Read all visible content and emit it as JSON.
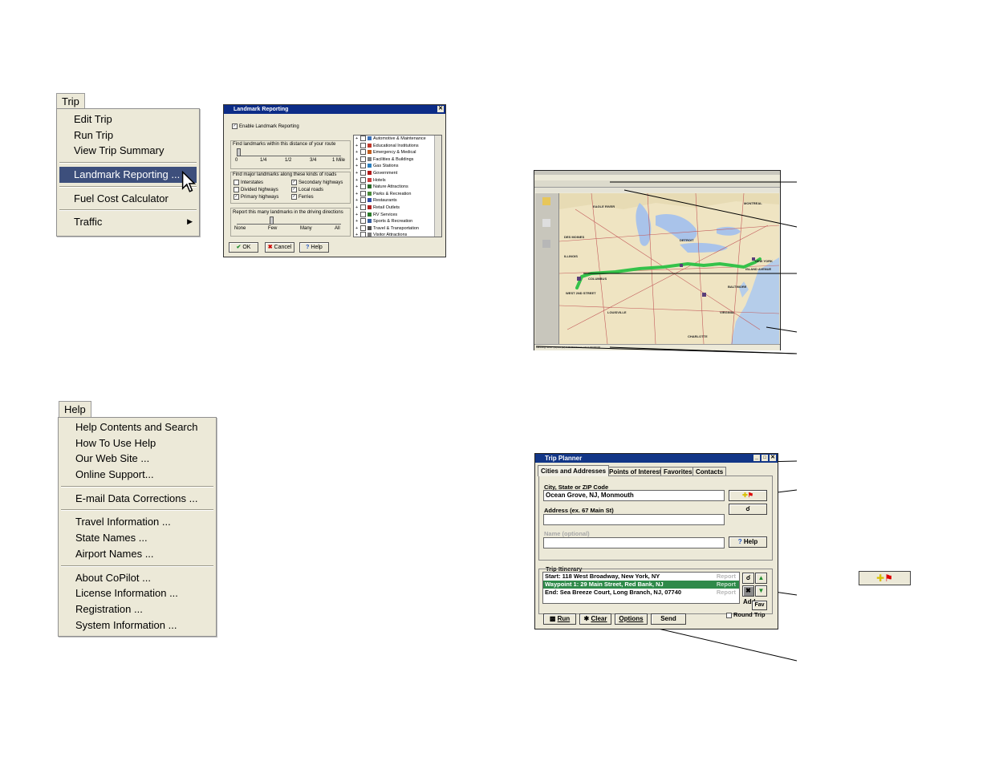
{
  "trip_menu": {
    "title": "Trip",
    "items": [
      "Edit Trip",
      "Run Trip",
      "View Trip Summary",
      "Landmark Reporting ...",
      "Fuel Cost Calculator",
      "Traffic"
    ]
  },
  "help_menu": {
    "title": "Help",
    "items": [
      "Help Contents and Search",
      "How To Use Help",
      "Our Web Site ...",
      "Online Support...",
      "E-mail Data Corrections ...",
      "Travel Information ...",
      "State Names ...",
      "Airport Names ...",
      "About CoPilot ...",
      "License Information ...",
      "Registration ...",
      "System Information ..."
    ]
  },
  "landmark_dialog": {
    "title": "Landmark Reporting",
    "enable_label": "Enable Landmark Reporting",
    "distance_caption": "Find landmarks within this distance of your route",
    "distance_ticks": [
      "0",
      "1/4",
      "1/2",
      "3/4",
      "1 Mile"
    ],
    "roads_caption": "Find major landmarks along these kinds of roads",
    "roads": [
      {
        "label": "Interstates",
        "checked": false
      },
      {
        "label": "Secondary highways",
        "checked": true
      },
      {
        "label": "Divided highways",
        "checked": false
      },
      {
        "label": "Local roads",
        "checked": true
      },
      {
        "label": "Primary highways",
        "checked": true
      },
      {
        "label": "Ferries",
        "checked": true
      }
    ],
    "report_caption": "Report this many landmarks in the driving directions",
    "report_ticks": [
      "None",
      "Few",
      "Many",
      "All"
    ],
    "categories": [
      "Automotive & Maintenance",
      "Educational Institutions",
      "Emergency & Medical",
      "Facilities & Buildings",
      "Gas Stations",
      "Government",
      "Hotels",
      "Nature Attractions",
      "Parks & Recreation",
      "Restaurants",
      "Retail Outlets",
      "RV Services",
      "Sports & Recreation",
      "Travel & Transportation",
      "Visitor Attractions"
    ],
    "ok_label": "OK",
    "cancel_label": "Cancel",
    "help_label": "Help"
  },
  "map_window": {
    "status_text": "Lat/Long: 40.27 (N) 0.0 (W) 0.00 BUFFALO, NY 0.00000000",
    "place_labels": [
      "EAGLE RIVER",
      "MONTREAL",
      "DES MOINES",
      "WEST 2ND STREET",
      "COLUMBUS",
      "DETROIT",
      "ILLINOIS",
      "ISLAND AVENUE",
      "NEW YORK",
      "BALTIMORE",
      "VIRGINIA",
      "LOUISVILLE",
      "CHARLOTTE"
    ]
  },
  "trip_planner": {
    "title": "Trip Planner",
    "tabs": [
      "Cities and Addresses",
      "Points of Interest",
      "Favorites",
      "Contacts"
    ],
    "city_label": "City, State or ZIP Code",
    "city_value": "Ocean Grove, NJ, Monmouth",
    "address_label": "Address (ex. 67 Main St)",
    "address_value": "",
    "name_label": "Name (optional)",
    "name_value": "",
    "help_label": "Help",
    "itinerary_label": "Trip Itinerary",
    "itinerary": [
      {
        "text": "Start: 118 West Broadway, New York, NY",
        "report": "Report",
        "selected": false
      },
      {
        "text": "Waypoint 1: 29 Main Street, Red Bank, NJ",
        "report": "Report",
        "selected": true
      },
      {
        "text": "End: Sea Breeze Court, Long Branch, NJ, 07740",
        "report": "Report",
        "selected": false
      }
    ],
    "add_label": "Add",
    "fav_label": "Fav",
    "round_trip_label": "Round Trip",
    "run_label": "Run",
    "clear_label": "Clear",
    "options_label": "Options",
    "send_label": "Send"
  },
  "colors": {
    "menu_bg": "#ece9d8",
    "highlight": "#3d4f7c",
    "titlebar": "#0c2c87",
    "route": "#35c24a",
    "selected_row": "#2f8a4a"
  }
}
